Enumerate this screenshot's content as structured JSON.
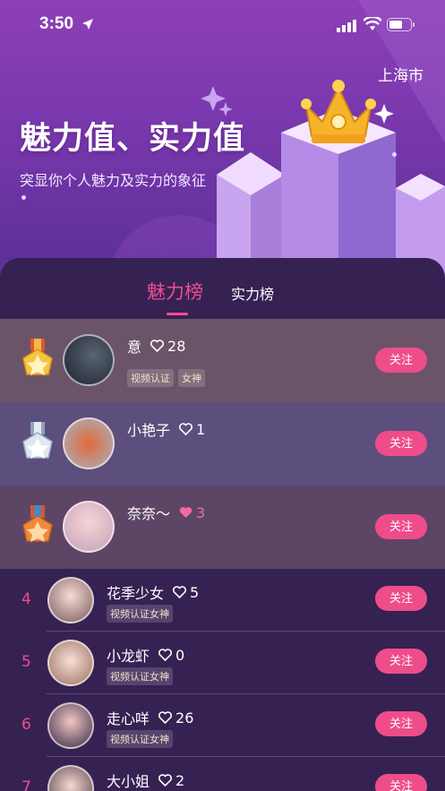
{
  "status_bar": {
    "time": "3:50"
  },
  "header": {
    "city": "上海市",
    "headline": "魅力值、实力值",
    "subline": "突显你个人魅力及实力的象征"
  },
  "tabs": [
    {
      "label": "魅力榜",
      "active": true
    },
    {
      "label": "实力榜",
      "active": false
    }
  ],
  "top3": [
    {
      "rank": 1,
      "medal": "gold-medal-icon",
      "name": "意",
      "hearts": "28",
      "tags": [
        "视频认证",
        "女神"
      ],
      "follow": "关注",
      "bg": "#6b5467"
    },
    {
      "rank": 2,
      "medal": "silver-medal-icon",
      "name": "小艳子",
      "hearts": "1",
      "tags": [],
      "follow": "关注",
      "bg": "#5c4e7d"
    },
    {
      "rank": 3,
      "medal": "bronze-medal-icon",
      "name": "奈奈～",
      "hearts": "3",
      "tags": [],
      "follow": "关注",
      "bg": "#5d4566"
    }
  ],
  "ranks": [
    {
      "rank": "4",
      "name": "花季少女",
      "hearts": "5",
      "tag": "视频认证女神",
      "follow": "关注"
    },
    {
      "rank": "5",
      "name": "小龙虾",
      "hearts": "0",
      "tag": "视频认证女神",
      "follow": "关注"
    },
    {
      "rank": "6",
      "name": "走心咩",
      "hearts": "26",
      "tag": "视频认证女神",
      "follow": "关注"
    },
    {
      "rank": "7",
      "name": "大小姐",
      "hearts": "2",
      "tag": "",
      "follow": "关注"
    }
  ],
  "colors": {
    "accent": "#ee4d8a",
    "panel": "#352253",
    "hero": "#8e3fb8"
  }
}
